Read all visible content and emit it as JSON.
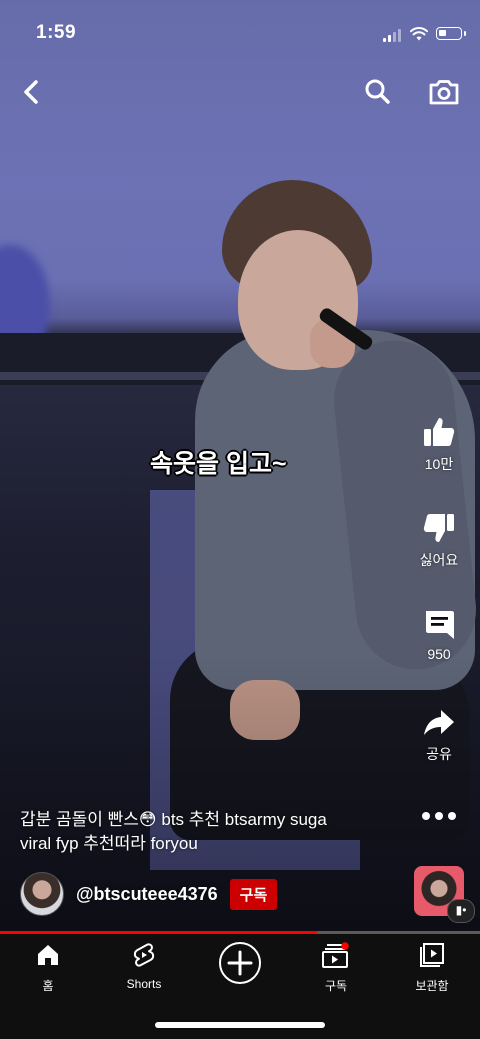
{
  "status_bar": {
    "time": "1:59",
    "battery_level": 0.35
  },
  "top_bar": {
    "back_icon": "chevron-left-icon",
    "search_icon": "search-icon",
    "camera_icon": "camera-icon"
  },
  "video": {
    "caption": "속옷을 입고~",
    "progress": 0.66
  },
  "actions": {
    "like_count": "10만",
    "dislike_label": "싫어요",
    "comment_count": "950",
    "share_label": "공유",
    "more_icon": "more-horizontal-icon"
  },
  "description": {
    "title_line1": "갑분 곰돌이 빤스😳 bts 추천 btsarmy suga",
    "title_line2": "viral fyp 추천떠라 foryou"
  },
  "channel": {
    "handle": "@btscuteee4376",
    "subscribe_label": "구독"
  },
  "nav": {
    "items": [
      {
        "label": "홈",
        "icon": "home-icon"
      },
      {
        "label": "Shorts",
        "icon": "shorts-icon"
      },
      {
        "label": "",
        "icon": "create-icon"
      },
      {
        "label": "구독",
        "icon": "subscriptions-icon"
      },
      {
        "label": "보관함",
        "icon": "library-icon"
      }
    ]
  },
  "colors": {
    "accent": "#ff0000",
    "subscribe_bg": "#cc0000",
    "nav_bg": "#0f0f0f"
  }
}
